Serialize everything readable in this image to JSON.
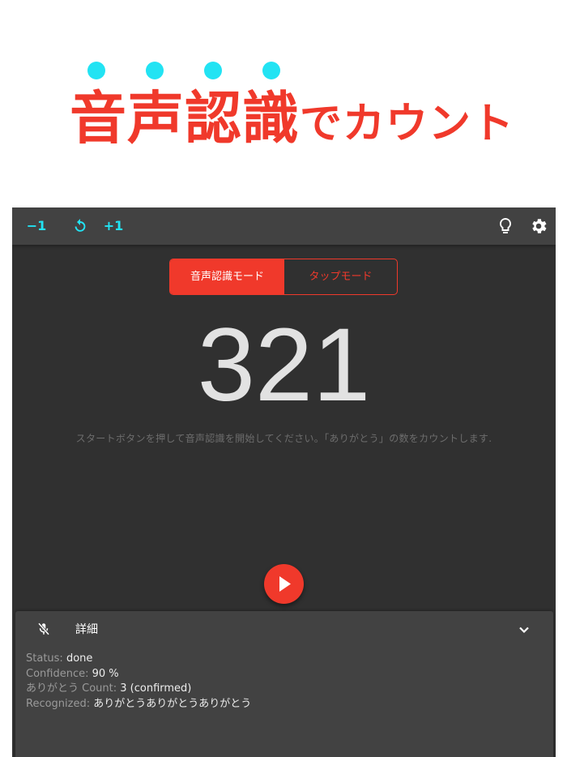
{
  "banner": {
    "headline_big": "音声認識",
    "headline_small": "でカウント",
    "dot_color": "#22e3f3",
    "text_color": "#f0392b"
  },
  "toolbar": {
    "minus_label": "−1",
    "plus_label": "+1",
    "icons": [
      "reset-icon",
      "lightbulb-icon",
      "gear-icon"
    ]
  },
  "mode_toggle": {
    "active_label": "音声認識モード",
    "inactive_label": "タップモード"
  },
  "counter": {
    "value": "321",
    "hint": "スタートボタンを押して音声認識を開始してください。「ありがとう」の数をカウントします."
  },
  "fab": {
    "icon": "play-icon",
    "color": "#f0392b"
  },
  "details": {
    "title": "詳細",
    "rows": [
      {
        "label": "Status: ",
        "value": "done"
      },
      {
        "label": "Confidence: ",
        "value": "90 %"
      },
      {
        "label": "ありがとう Count: ",
        "value": "3  (confirmed)"
      },
      {
        "label": "Recognized: ",
        "value": "ありがとうありがとうありがとう"
      }
    ]
  }
}
